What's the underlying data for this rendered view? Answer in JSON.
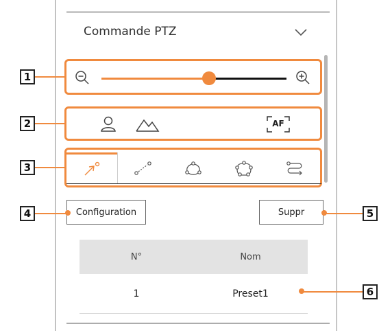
{
  "header": {
    "title": "Commande PTZ",
    "chevron_icon": "chevron-down-icon"
  },
  "zoom": {
    "minus_icon": "zoom-out-icon",
    "plus_icon": "zoom-in-icon",
    "level": 0.58
  },
  "focus": {
    "icons": [
      "person-icon",
      "mountain-icon"
    ],
    "af_label": "AF"
  },
  "tabs": [
    {
      "icon": "preset-arrow-icon",
      "active": true
    },
    {
      "icon": "swing-icon",
      "active": false
    },
    {
      "icon": "group-icon",
      "active": false
    },
    {
      "icon": "tour-icon",
      "active": false
    },
    {
      "icon": "trace-icon",
      "active": false
    }
  ],
  "buttons": {
    "config_label": "Configuration",
    "delete_label": "Suppr"
  },
  "table": {
    "headers": [
      "N°",
      "Nom"
    ],
    "rows": [
      {
        "no": "1",
        "name": "Preset1"
      }
    ]
  },
  "callouts": [
    "1",
    "2",
    "3",
    "4",
    "5",
    "6"
  ],
  "colors": {
    "accent": "#f08a3e",
    "text": "#2b2b2b",
    "table_header_bg": "#e3e3e3"
  }
}
